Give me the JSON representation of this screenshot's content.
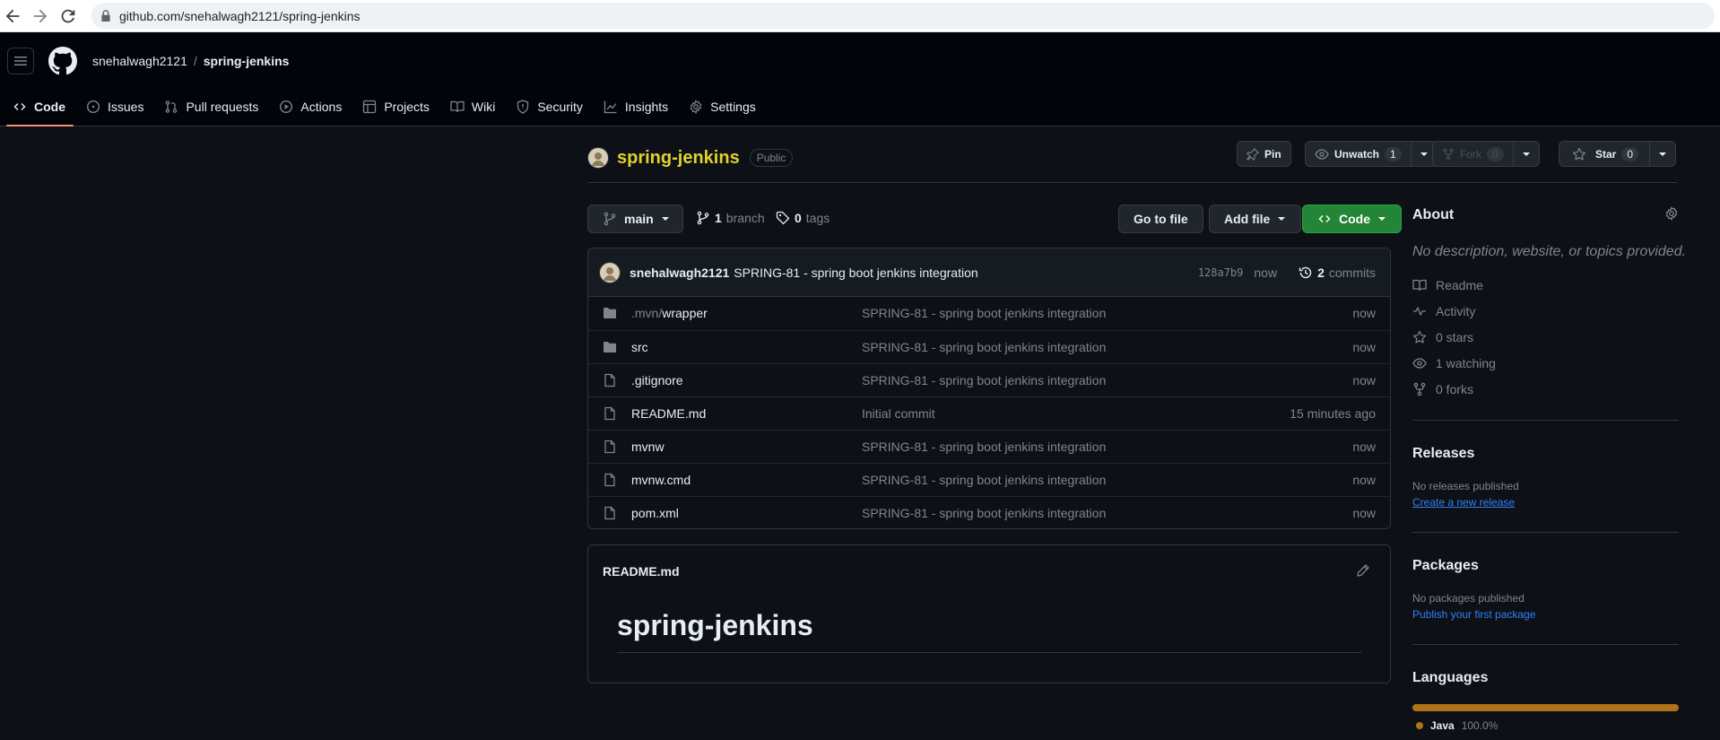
{
  "browser": {
    "url": "github.com/snehalwagh2121/spring-jenkins"
  },
  "header": {
    "owner": "snehalwagh2121",
    "separator": "/",
    "repo": "spring-jenkins",
    "tabs": [
      {
        "label": "Code",
        "icon": "code-icon",
        "active": true
      },
      {
        "label": "Issues",
        "icon": "issue-opened-icon"
      },
      {
        "label": "Pull requests",
        "icon": "git-pull-request-icon"
      },
      {
        "label": "Actions",
        "icon": "play-icon"
      },
      {
        "label": "Projects",
        "icon": "table-icon"
      },
      {
        "label": "Wiki",
        "icon": "book-icon"
      },
      {
        "label": "Security",
        "icon": "shield-icon"
      },
      {
        "label": "Insights",
        "icon": "graph-icon"
      },
      {
        "label": "Settings",
        "icon": "gear-icon"
      }
    ]
  },
  "repo": {
    "name": "spring-jenkins",
    "visibility": "Public",
    "pin_label": "Pin",
    "unwatch_label": "Unwatch",
    "watch_count": "1",
    "fork_label": "Fork",
    "fork_count": "0",
    "star_label": "Star",
    "star_count": "0"
  },
  "branch": {
    "current": "main",
    "branch_count": "1",
    "branch_label": "branch",
    "tag_count": "0",
    "tag_label": "tags",
    "goto_file": "Go to file",
    "add_file": "Add file",
    "code": "Code"
  },
  "commit": {
    "author": "snehalwagh2121",
    "message": "SPRING-81 - spring boot jenkins integration",
    "sha": "128a7b9",
    "time": "now",
    "count": "2",
    "count_label": "commits"
  },
  "files": [
    {
      "type": "dir",
      "prefix": ".mvn/",
      "name": "wrapper",
      "message": "SPRING-81 - spring boot jenkins integration",
      "age": "now"
    },
    {
      "type": "dir",
      "prefix": "",
      "name": "src",
      "message": "SPRING-81 - spring boot jenkins integration",
      "age": "now"
    },
    {
      "type": "file",
      "prefix": "",
      "name": ".gitignore",
      "message": "SPRING-81 - spring boot jenkins integration",
      "age": "now"
    },
    {
      "type": "file",
      "prefix": "",
      "name": "README.md",
      "message": "Initial commit",
      "age": "15 minutes ago"
    },
    {
      "type": "file",
      "prefix": "",
      "name": "mvnw",
      "message": "SPRING-81 - spring boot jenkins integration",
      "age": "now"
    },
    {
      "type": "file",
      "prefix": "",
      "name": "mvnw.cmd",
      "message": "SPRING-81 - spring boot jenkins integration",
      "age": "now"
    },
    {
      "type": "file",
      "prefix": "",
      "name": "pom.xml",
      "message": "SPRING-81 - spring boot jenkins integration",
      "age": "now"
    }
  ],
  "readme": {
    "filename": "README.md",
    "heading": "spring-jenkins"
  },
  "sidebar": {
    "about_title": "About",
    "about_desc": "No description, website, or topics provided.",
    "stats": [
      {
        "icon": "book-icon",
        "label": "Readme"
      },
      {
        "icon": "pulse-icon",
        "label": "Activity"
      },
      {
        "icon": "star-icon",
        "label": "0 stars"
      },
      {
        "icon": "eye-icon",
        "label": "1 watching"
      },
      {
        "icon": "repo-forked-icon",
        "label": "0 forks"
      }
    ],
    "releases_title": "Releases",
    "releases_none": "No releases published",
    "releases_link": "Create a new release",
    "packages_title": "Packages",
    "packages_none": "No packages published",
    "packages_link": "Publish your first package",
    "languages_title": "Languages",
    "languages": [
      {
        "name": "Java",
        "percent": "100.0%",
        "color": "#b07219"
      }
    ]
  },
  "colors": {
    "background": "#0d1117",
    "header_bg": "#010409",
    "accent_tab": "#fd8c73",
    "code_button": "#238636",
    "link": "#2f81f7",
    "repo_title": "#e3d12b"
  }
}
